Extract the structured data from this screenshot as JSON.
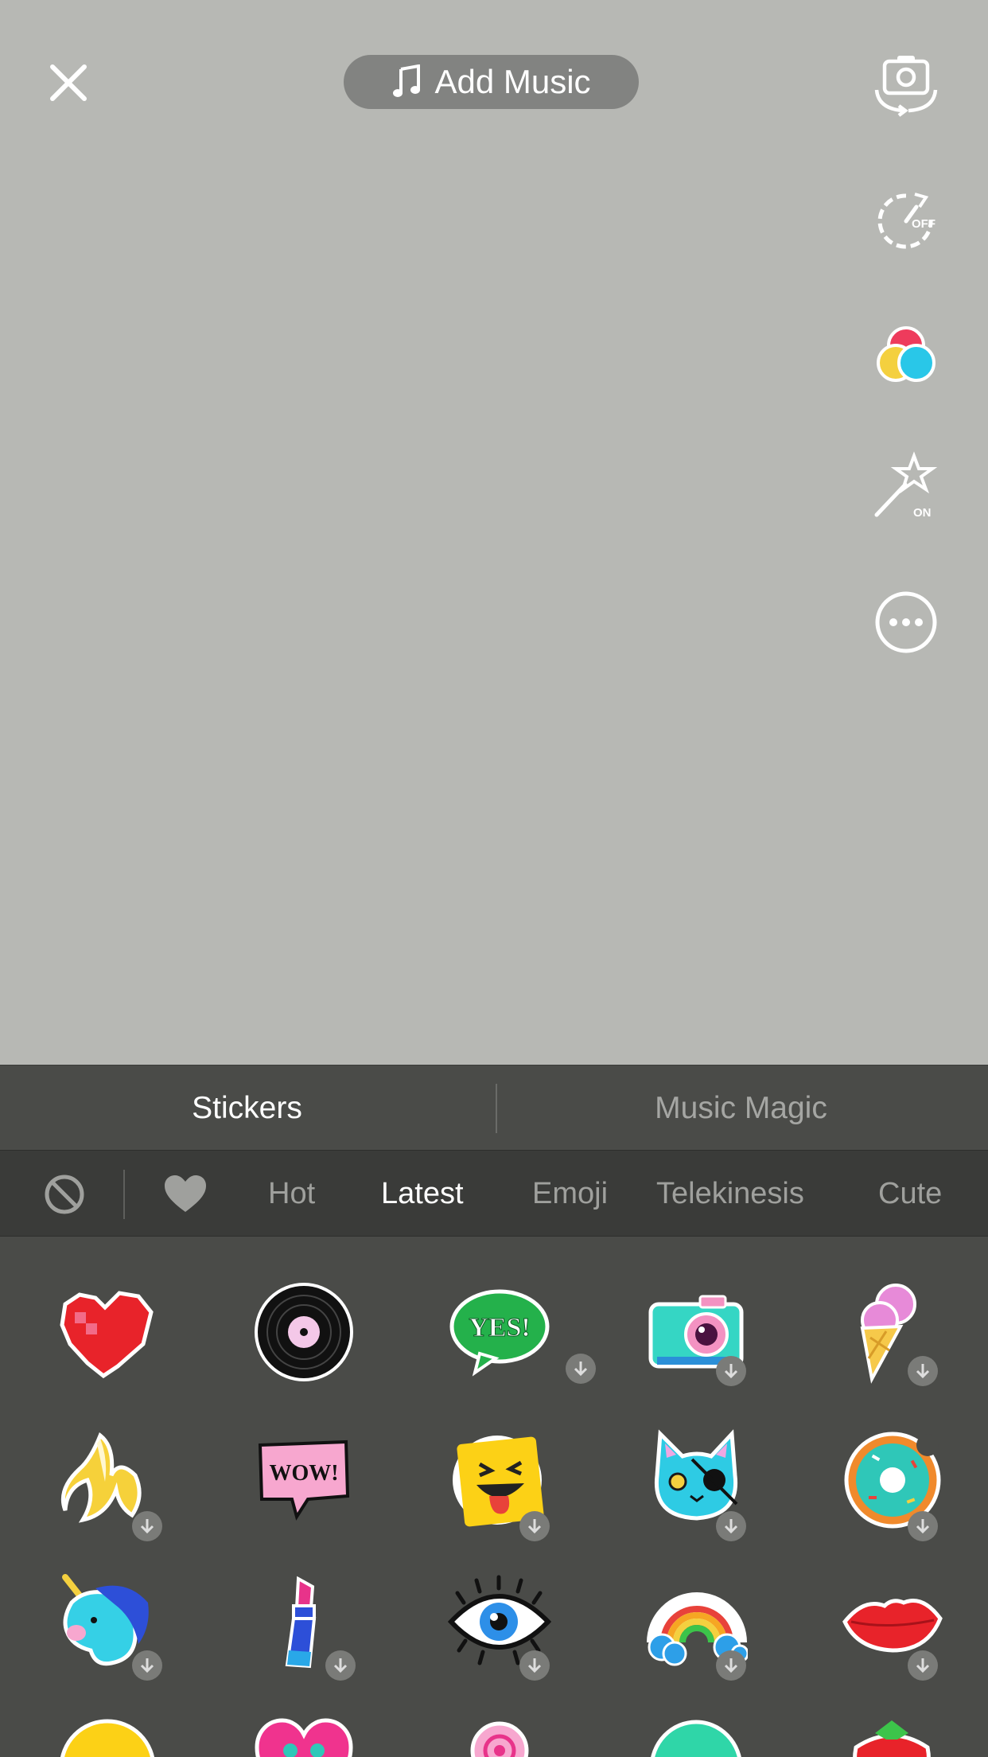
{
  "header": {
    "add_music_label": "Add Music"
  },
  "side_rail": {
    "speed_badge": "OFF",
    "beauty_badge": "ON"
  },
  "panel": {
    "tabs": [
      {
        "label": "Stickers",
        "active": true
      },
      {
        "label": "Music Magic",
        "active": false
      }
    ],
    "categories": [
      {
        "label": "Hot",
        "active": false
      },
      {
        "label": "Latest",
        "active": true
      },
      {
        "label": "Emoji",
        "active": false
      },
      {
        "label": "Telekinesis",
        "active": false
      },
      {
        "label": "Cute",
        "active": false
      }
    ],
    "sticker_texts": {
      "yes": "YES!",
      "wow": "WOW!"
    }
  },
  "colors": {
    "camera_bg": "#b7b8b4",
    "panel_bg": "#4a4b48",
    "category_bar_bg": "#3a3b39",
    "music_pill_bg": "#828381"
  }
}
